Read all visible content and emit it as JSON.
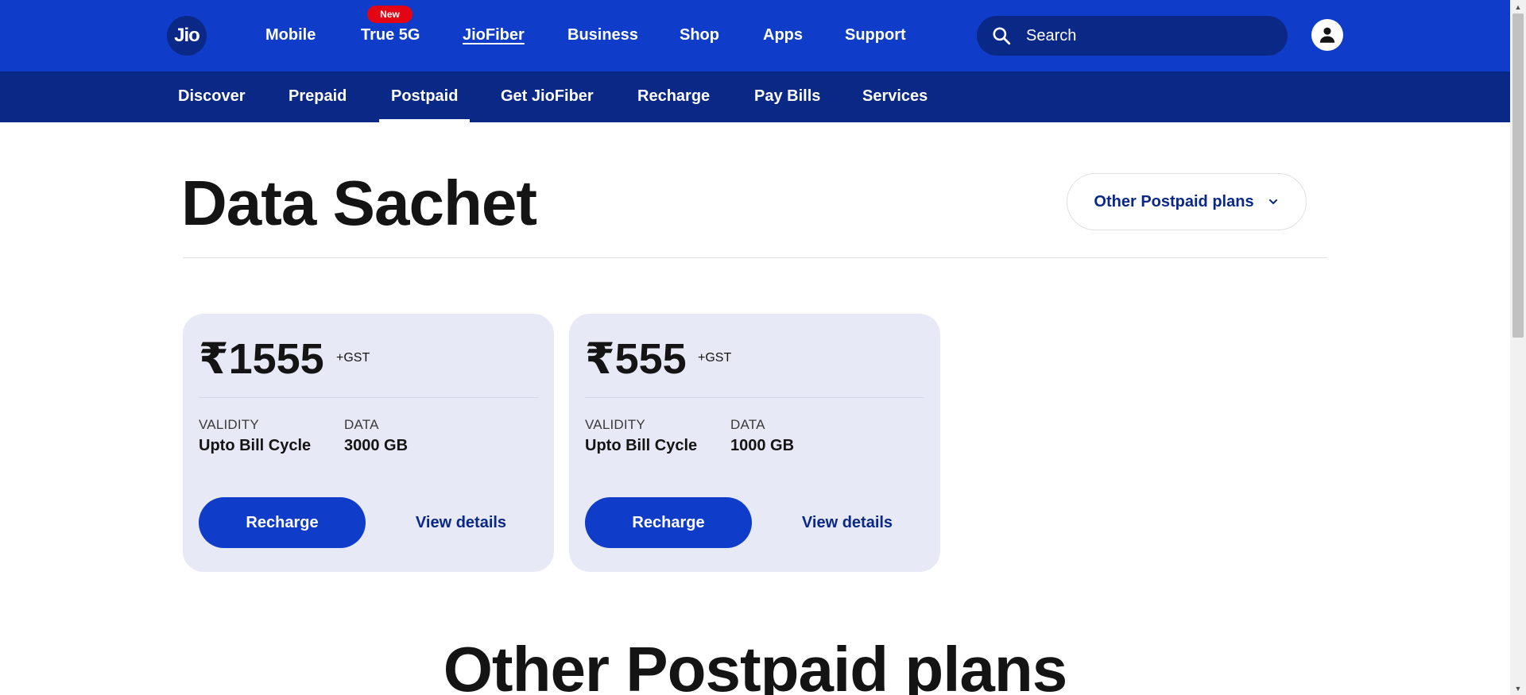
{
  "header": {
    "logo_text": "Jio",
    "nav": [
      {
        "label": "Mobile"
      },
      {
        "label": "True 5G",
        "badge": "New"
      },
      {
        "label": "JioFiber",
        "active": true
      },
      {
        "label": "Business"
      },
      {
        "label": "Shop"
      },
      {
        "label": "Apps"
      },
      {
        "label": "Support"
      }
    ],
    "search_placeholder": "Search"
  },
  "subnav": {
    "items": [
      {
        "label": "Discover"
      },
      {
        "label": "Prepaid"
      },
      {
        "label": "Postpaid",
        "active": true
      },
      {
        "label": "Get JioFiber"
      },
      {
        "label": "Recharge"
      },
      {
        "label": "Pay Bills"
      },
      {
        "label": "Services"
      }
    ]
  },
  "main": {
    "title": "Data Sachet",
    "plans_dropdown_label": "Other Postpaid plans",
    "cards": [
      {
        "price": "₹1555",
        "gst": "+GST",
        "validity_label": "VALIDITY",
        "validity_value": "Upto Bill Cycle",
        "data_label": "DATA",
        "data_value": "3000 GB",
        "recharge_label": "Recharge",
        "details_label": "View details"
      },
      {
        "price": "₹555",
        "gst": "+GST",
        "validity_label": "VALIDITY",
        "validity_value": "Upto Bill Cycle",
        "data_label": "DATA",
        "data_value": "1000 GB",
        "recharge_label": "Recharge",
        "details_label": "View details"
      }
    ],
    "section_title": "Other Postpaid plans"
  },
  "colors": {
    "header_blue": "#0f3cc9",
    "subnav_navy": "#0a2885",
    "badge_red": "#e30513",
    "card_bg": "#e7e9f6"
  }
}
